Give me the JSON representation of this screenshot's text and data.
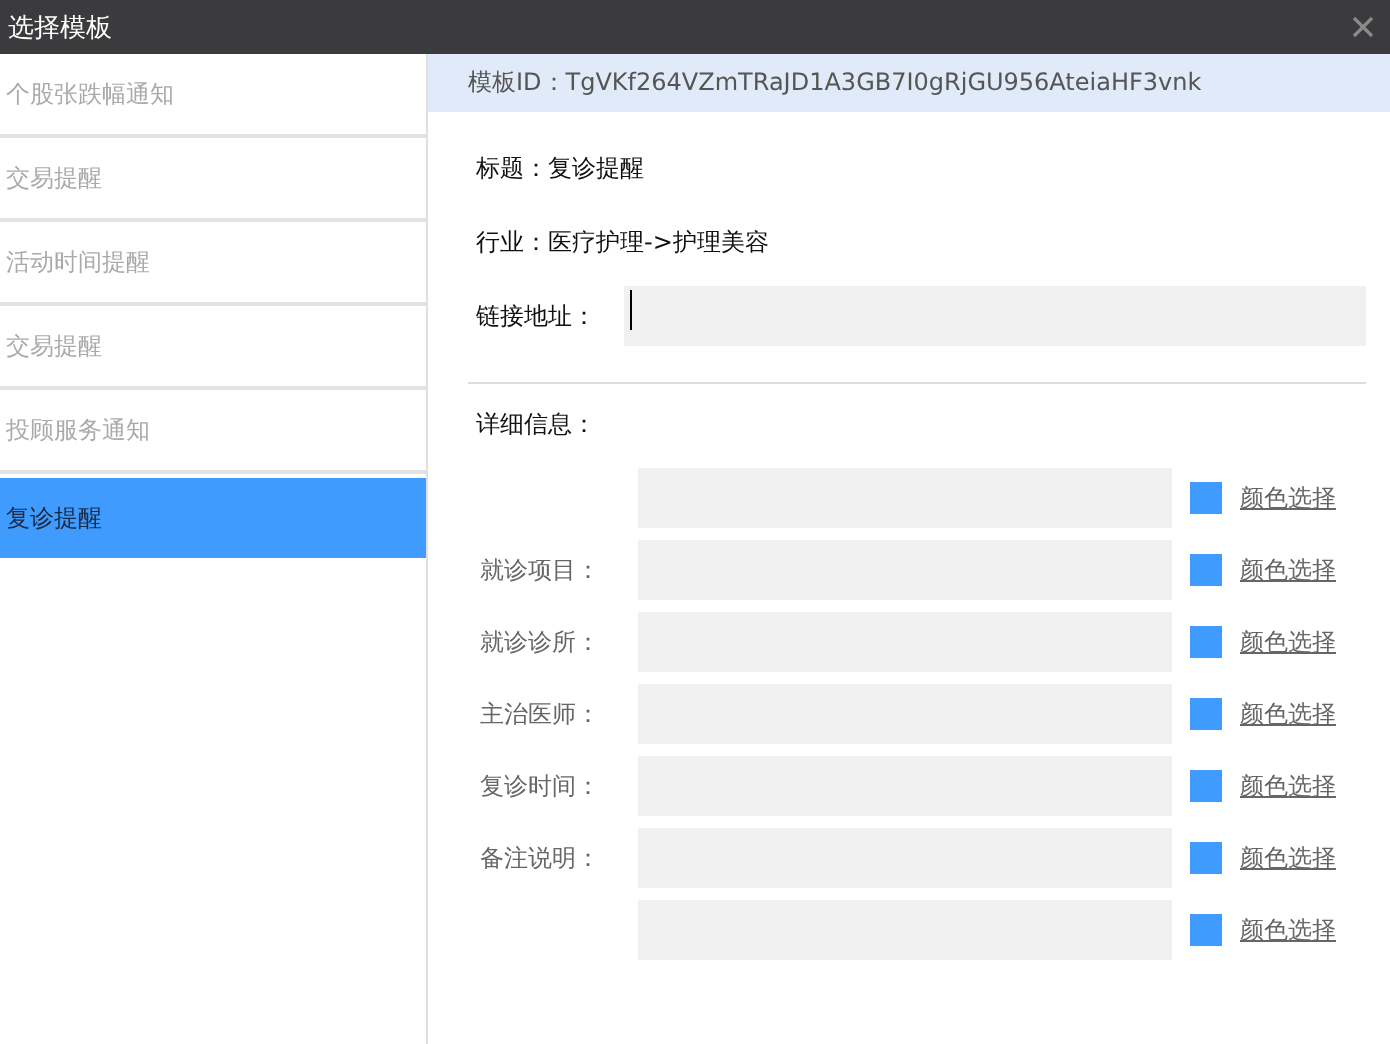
{
  "window": {
    "title": "选择模板"
  },
  "sidebar": {
    "items": [
      {
        "label": "个股张跌幅通知",
        "selected": false
      },
      {
        "label": "交易提醒",
        "selected": false
      },
      {
        "label": "活动时间提醒",
        "selected": false
      },
      {
        "label": "交易提醒",
        "selected": false
      },
      {
        "label": "投顾服务通知",
        "selected": false
      },
      {
        "label": "复诊提醒",
        "selected": true
      }
    ]
  },
  "template_id": "模板ID：TgVKf264VZmTRaJD1A3GB7I0gRjGU956AteiaHF3vnk",
  "title_line": "标题：复诊提醒",
  "industry_line": "行业：医疗护理->护理美容",
  "link_label": "链接地址：",
  "details_label": "详细信息：",
  "detail_rows": [
    {
      "color_link": "颜色选择"
    },
    {
      "label": "就诊项目：",
      "color_link": "颜色选择"
    },
    {
      "label": "就诊诊所：",
      "color_link": "颜色选择"
    },
    {
      "label": "主治医师：",
      "color_link": "颜色选择"
    },
    {
      "label": "复诊时间：",
      "color_link": "颜色选择"
    },
    {
      "label": "备注说明：",
      "color_link": "颜色选择"
    },
    {
      "color_link": "颜色选择"
    }
  ]
}
